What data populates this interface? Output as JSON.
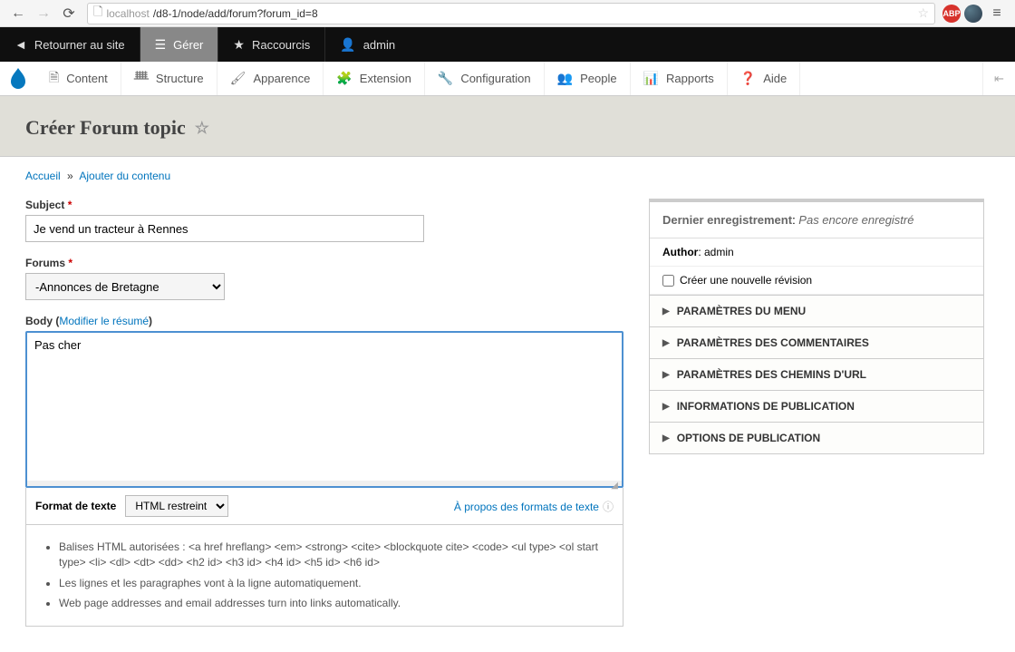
{
  "browser": {
    "url_prefix": "localhost",
    "url_path": "/d8-1/node/add/forum?forum_id=8"
  },
  "toolbar_top": {
    "back_to_site": "Retourner au site",
    "manage": "Gérer",
    "shortcuts": "Raccourcis",
    "user": "admin"
  },
  "toolbar_admin": {
    "content": "Content",
    "structure": "Structure",
    "appearance": "Apparence",
    "extend": "Extension",
    "configuration": "Configuration",
    "people": "People",
    "reports": "Rapports",
    "help": "Aide"
  },
  "page": {
    "title": "Créer Forum topic"
  },
  "breadcrumb": {
    "home": "Accueil",
    "sep": "»",
    "add": "Ajouter du contenu"
  },
  "form": {
    "subject_label": "Subject",
    "subject_value": "Je vend un tracteur à Rennes",
    "forums_label": "Forums",
    "forums_value": "-Annonces de Bretagne",
    "body_label": "Body ",
    "body_open": "(",
    "body_close": ")",
    "edit_summary": "Modifier le résumé",
    "body_value": "Pas cher",
    "format_label": "Format de texte",
    "format_value": "HTML restreint",
    "about_formats": "À propos des formats de texte"
  },
  "tips": {
    "t1": "Balises HTML autorisées : <a href hreflang> <em> <strong> <cite> <blockquote cite> <code> <ul type> <ol start type> <li> <dl> <dt> <dd> <h2 id> <h3 id> <h4 id> <h5 id> <h6 id>",
    "t2": "Les lignes et les paragraphes vont à la ligne automatiquement.",
    "t3": "Web page addresses and email addresses turn into links automatically."
  },
  "sidebar": {
    "last_saved_label": "Dernier enregistrement",
    "last_saved_value": "Pas encore enregistré",
    "author_label": "Author",
    "author_value": "admin",
    "new_revision": "Créer une nouvelle révision",
    "accordion": {
      "menu": "PARAMÈTRES DU MENU",
      "comments": "PARAMÈTRES DES COMMENTAIRES",
      "url": "PARAMÈTRES DES CHEMINS D'URL",
      "publish_info": "INFORMATIONS DE PUBLICATION",
      "publish_opts": "OPTIONS DE PUBLICATION"
    }
  }
}
